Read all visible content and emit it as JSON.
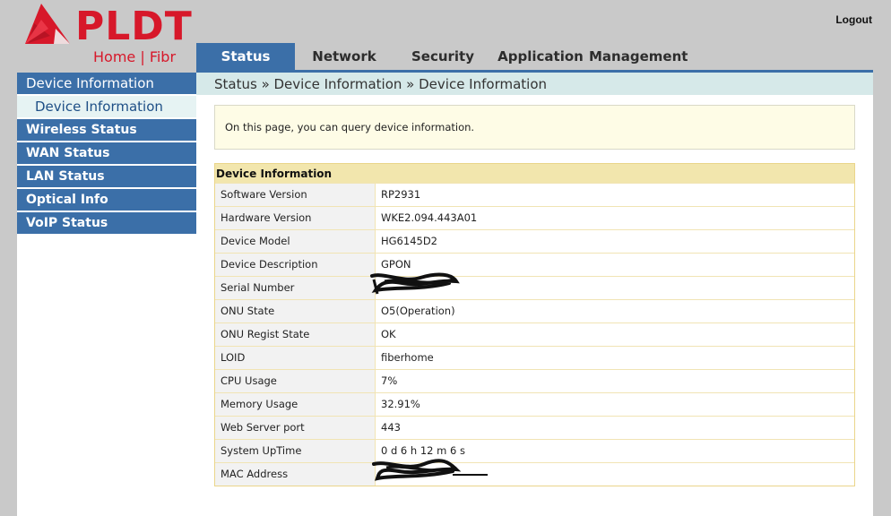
{
  "header": {
    "logo_text": "PLDT",
    "logo_subtitle": "Home | Fibr",
    "logout_label": "Logout"
  },
  "tabs": [
    {
      "label": "Status",
      "active": true
    },
    {
      "label": "Network",
      "active": false
    },
    {
      "label": "Security",
      "active": false
    },
    {
      "label": "Application",
      "active": false
    },
    {
      "label": "Management",
      "active": false
    }
  ],
  "sidebar": {
    "section_label": "Device Information",
    "sub_items": [
      "Device Information"
    ],
    "items": [
      "Wireless Status",
      "WAN Status",
      "LAN Status",
      "Optical Info",
      "VoIP Status"
    ]
  },
  "breadcrumb": "Status » Device Information » Device Information",
  "note": "On this page, you can query device information.",
  "device_info": {
    "title": "Device Information",
    "rows": [
      {
        "label": "Software Version",
        "value": "RP2931"
      },
      {
        "label": "Hardware Version",
        "value": "WKE2.094.443A01"
      },
      {
        "label": "Device Model",
        "value": "HG6145D2"
      },
      {
        "label": "Device Description",
        "value": "GPON"
      },
      {
        "label": "Serial Number",
        "value": ""
      },
      {
        "label": "ONU State",
        "value": "O5(Operation)"
      },
      {
        "label": "ONU Regist State",
        "value": "OK"
      },
      {
        "label": "LOID",
        "value": "fiberhome"
      },
      {
        "label": "CPU Usage",
        "value": "7%"
      },
      {
        "label": "Memory Usage",
        "value": "32.91%"
      },
      {
        "label": "Web Server port",
        "value": "443"
      },
      {
        "label": "System UpTime",
        "value": "0 d 6 h 12 m 6 s"
      },
      {
        "label": "MAC Address",
        "value": ""
      }
    ]
  },
  "colors": {
    "brand_red": "#d7182a",
    "nav_blue": "#3b6fa8",
    "breadcrumb_bg": "#d6e9e9",
    "table_header_bg": "#f2e6ad"
  }
}
